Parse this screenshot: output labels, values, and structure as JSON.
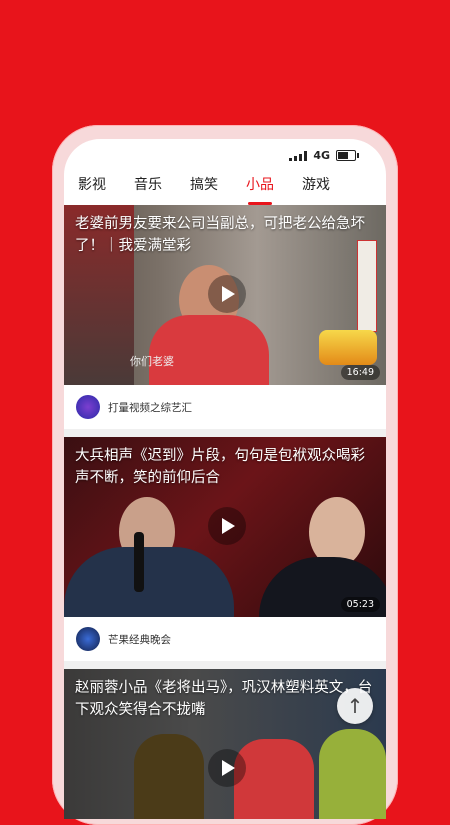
{
  "status": {
    "network": "4G"
  },
  "tabs": [
    {
      "label": "影视"
    },
    {
      "label": "音乐"
    },
    {
      "label": "搞笑"
    },
    {
      "label": "小品",
      "active": true
    },
    {
      "label": "游戏"
    }
  ],
  "cards": [
    {
      "title": "老婆前男友要来公司当副总，可把老公给急坏了！｜我爱满堂彩",
      "duration": "16:49",
      "channel": "打量视频之综艺汇",
      "overlay_text": "你们老婆"
    },
    {
      "title": "大兵相声《迟到》片段，句句是包袱观众喝彩声不断，笑的前仰后合",
      "duration": "05:23",
      "channel": "芒果经典晚会"
    },
    {
      "title": "赵丽蓉小品《老将出马》，巩汉林塑料英文，台下观众笑得合不拢嘴"
    }
  ],
  "controls": {
    "back_to_top": "↑"
  },
  "colors": {
    "brand_red": "#e8141b"
  }
}
